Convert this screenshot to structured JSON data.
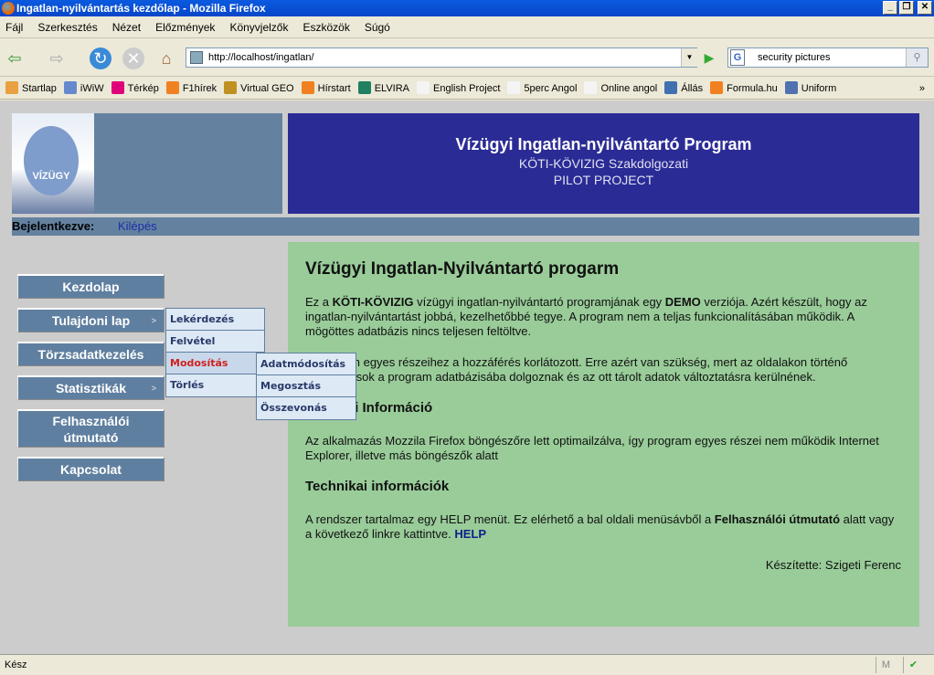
{
  "window": {
    "title": "Ingatlan-nyilvántartás kezdőlap - Mozilla Firefox",
    "buttons": [
      "_",
      "❐",
      "✕"
    ]
  },
  "menubar": [
    "Fájl",
    "Szerkesztés",
    "Nézet",
    "Előzmények",
    "Könyvjelzők",
    "Eszközök",
    "Súgó"
  ],
  "navbar": {
    "url": "http://localhost/ingatlan/",
    "search_value": "security pictures",
    "search_engine": "G"
  },
  "bookmarks": [
    {
      "label": "Startlap",
      "color": "#e8a040"
    },
    {
      "label": "iWiW",
      "color": "#6688cc"
    },
    {
      "label": "Térkép",
      "color": "#e0007a"
    },
    {
      "label": "F1hírek",
      "color": "#f08020"
    },
    {
      "label": "Virtual GEO",
      "color": "#c09020"
    },
    {
      "label": "Hírstart",
      "color": "#f08020"
    },
    {
      "label": "ELVIRA",
      "color": "#208060"
    },
    {
      "label": "English Project",
      "color": "#f4f4f4"
    },
    {
      "label": "5perc Angol",
      "color": "#f4f4f4"
    },
    {
      "label": "Online angol",
      "color": "#f4f4f4"
    },
    {
      "label": "Állás",
      "color": "#4070b0"
    },
    {
      "label": "Formula.hu",
      "color": "#f08020"
    },
    {
      "label": "Uniform",
      "color": "#5070b0"
    }
  ],
  "bookmarks_more": "»",
  "header": {
    "logo_text": "VÍZÜGY",
    "title": "Vízügyi Ingatlan-nyilvántartó Program",
    "subtitle": "KÖTI-KÖVIZIG Szakdolgozati",
    "subtitle2": "PILOT PROJECT"
  },
  "login": {
    "label": "Bejelentkezve:",
    "logout": "Kilépés"
  },
  "menu": [
    {
      "label": "Kezdolap"
    },
    {
      "label": "Tulajdoni lap",
      "arrow": ">"
    },
    {
      "label": "Törzsadatkezelés"
    },
    {
      "label": "Statisztikák",
      "arrow": ">"
    },
    {
      "label": "Felhasználói útmutató"
    },
    {
      "label": "Kapcsolat"
    }
  ],
  "submenu": [
    "Lekérdezés",
    "Felvétel",
    "Modosítás",
    "Törlés"
  ],
  "submenu2": [
    "Adatmódosítás",
    "Megosztás",
    "Összevonás"
  ],
  "content": {
    "title": "Vízügyi Ingatlan-Nyilvántartó progarm",
    "p1_a": "Ez a ",
    "p1_b": "KÖTI-KÖVIZIG",
    "p1_c": " vízügyi ingatlan-nyilvántartó programjának egy ",
    "p1_d": "DEMO",
    "p1_e": " verziója. Azért készült, hogy az ingatlan-nyilvántartást jobbá, kezelhetőbbé tegye. A program nem a teljas funkcionalításában működik. A mögöttes adatbázis nincs teljesen feltöltve.",
    "p2": "A program egyes részeihez a hozzáférés korlátozott. Erre azért van szükség, mert az oldalakon történő változtatások a program adatbázisába dolgoznak és az ott tárolt adatok változtatásra kerülnének.",
    "h2a": "Műszaki Információ",
    "p3": "Az alkalmazás Mozzila Firefox böngészőre lett optimailzálva, így program egyes részei nem működik Internet Explorer, illetve más böngészők alatt",
    "h2b": "Technikai információk",
    "p4_a": "A rendszer tartalmaz egy HELP menüt. Ez elérhető a bal oldali menüsávből a ",
    "p4_b": "Felhasználói útmutató",
    "p4_c": " alatt vagy a következő linkre kattintve. ",
    "p4_link": "HELP",
    "signature": "Készítette: Szigeti Ferenc"
  },
  "status": {
    "text": "Kész"
  }
}
